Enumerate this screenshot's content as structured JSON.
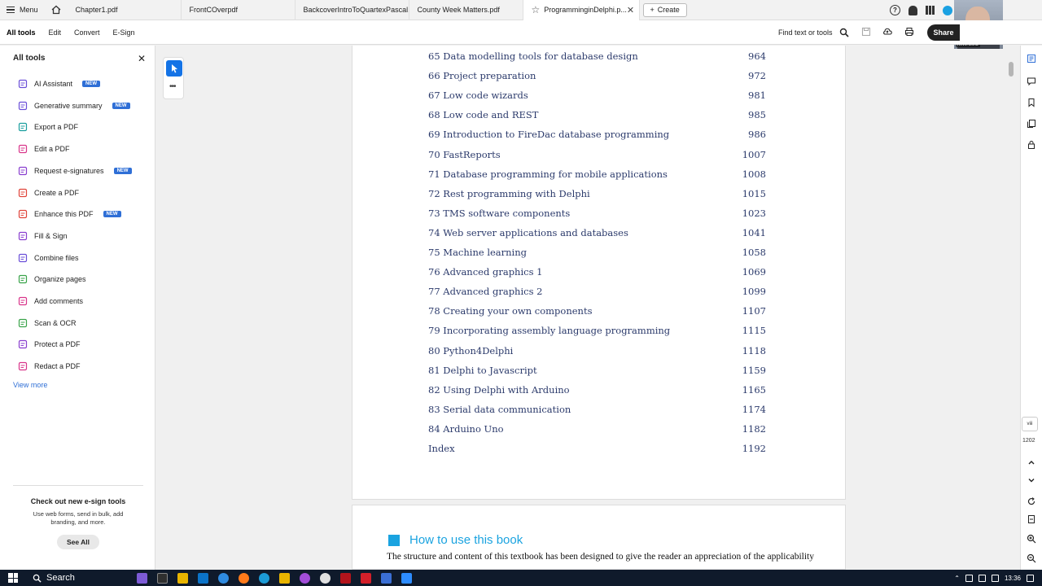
{
  "menu_label": "Menu",
  "tabs": [
    {
      "label": "Chapter1.pdf"
    },
    {
      "label": "FrontCOverpdf"
    },
    {
      "label": "BackcoverIntroToQuartexPascal..."
    },
    {
      "label": "County Week Matters.pdf"
    },
    {
      "label": "ProgramminginDelphi.p..."
    }
  ],
  "create_label": "Create",
  "share_label": "Share",
  "webcam_name": "Kevin Bond",
  "toolbar": {
    "tabs": [
      "All tools",
      "Edit",
      "Convert",
      "E-Sign"
    ],
    "find_label": "Find text or tools"
  },
  "sidebar": {
    "title": "All tools",
    "items": [
      {
        "label": "AI Assistant",
        "badge": "NEW",
        "icon": "ai-assistant-icon",
        "color": "#6b4fd8"
      },
      {
        "label": "Generative summary",
        "badge": "NEW",
        "icon": "summary-icon",
        "color": "#6b4fd8"
      },
      {
        "label": "Export a PDF",
        "badge": "",
        "icon": "export-pdf-icon",
        "color": "#1a9e9e"
      },
      {
        "label": "Edit a PDF",
        "badge": "",
        "icon": "edit-pdf-icon",
        "color": "#d9368b"
      },
      {
        "label": "Request e-signatures",
        "badge": "NEW",
        "icon": "e-signature-icon",
        "color": "#8a3fcf"
      },
      {
        "label": "Create a PDF",
        "badge": "",
        "icon": "create-pdf-icon",
        "color": "#e0443a"
      },
      {
        "label": "Enhance this PDF",
        "badge": "NEW",
        "icon": "enhance-pdf-icon",
        "color": "#e0443a"
      },
      {
        "label": "Fill & Sign",
        "badge": "",
        "icon": "fill-sign-icon",
        "color": "#8a3fcf"
      },
      {
        "label": "Combine files",
        "badge": "",
        "icon": "combine-files-icon",
        "color": "#6b4fd8"
      },
      {
        "label": "Organize pages",
        "badge": "",
        "icon": "organize-pages-icon",
        "color": "#3aa34a"
      },
      {
        "label": "Add comments",
        "badge": "",
        "icon": "comment-icon",
        "color": "#d9368b"
      },
      {
        "label": "Scan & OCR",
        "badge": "",
        "icon": "scan-ocr-icon",
        "color": "#3aa34a"
      },
      {
        "label": "Protect a PDF",
        "badge": "",
        "icon": "protect-pdf-icon",
        "color": "#8a3fcf"
      },
      {
        "label": "Redact a PDF",
        "badge": "",
        "icon": "redact-pdf-icon",
        "color": "#d9368b"
      }
    ],
    "view_more": "View more",
    "promo": {
      "title": "Check out new e-sign tools",
      "text1": "Use web forms, send in bulk, add",
      "text2": "branding, and more.",
      "button": "See All"
    }
  },
  "toc": [
    {
      "title": "65 Data modelling tools for database design",
      "page": "964"
    },
    {
      "title": "66 Project preparation",
      "page": "972"
    },
    {
      "title": "67 Low code wizards",
      "page": "981"
    },
    {
      "title": "68 Low code and REST",
      "page": "985"
    },
    {
      "title": "69 Introduction to FireDac database programming",
      "page": "986"
    },
    {
      "title": "70 FastReports",
      "page": "1007"
    },
    {
      "title": "71 Database programming for mobile applications",
      "page": "1008"
    },
    {
      "title": "72 Rest programming with Delphi",
      "page": "1015"
    },
    {
      "title": "73 TMS software components",
      "page": "1023"
    },
    {
      "title": "74 Web server applications and databases",
      "page": "1041"
    },
    {
      "title": "75 Machine learning",
      "page": "1058"
    },
    {
      "title": "76 Advanced graphics 1",
      "page": "1069"
    },
    {
      "title": "77 Advanced graphics 2",
      "page": "1099"
    },
    {
      "title": "78 Creating your own components",
      "page": "1107"
    },
    {
      "title": "79 Incorporating assembly language programming",
      "page": "1115"
    },
    {
      "title": "80 Python4Delphi",
      "page": "1118"
    },
    {
      "title": "81 Delphi to Javascript",
      "page": "1159"
    },
    {
      "title": "82 Using Delphi with Arduino",
      "page": "1165"
    },
    {
      "title": "83 Serial data communication",
      "page": "1174"
    },
    {
      "title": "84 Arduino Uno",
      "page": "1182"
    },
    {
      "title": "Index",
      "page": "1192"
    }
  ],
  "next_page": {
    "heading": "How to use this book",
    "paragraph": "The structure and content of this textbook has been designed to give the reader an appreciation of the applicability"
  },
  "page_indicator": {
    "current": "viii",
    "total": "1202"
  },
  "taskbar": {
    "search": "Search",
    "time": "13:36"
  },
  "colors": {
    "accent": "#1473e6",
    "toc_text": "#2b3a6b",
    "heading": "#1aa3e0"
  }
}
